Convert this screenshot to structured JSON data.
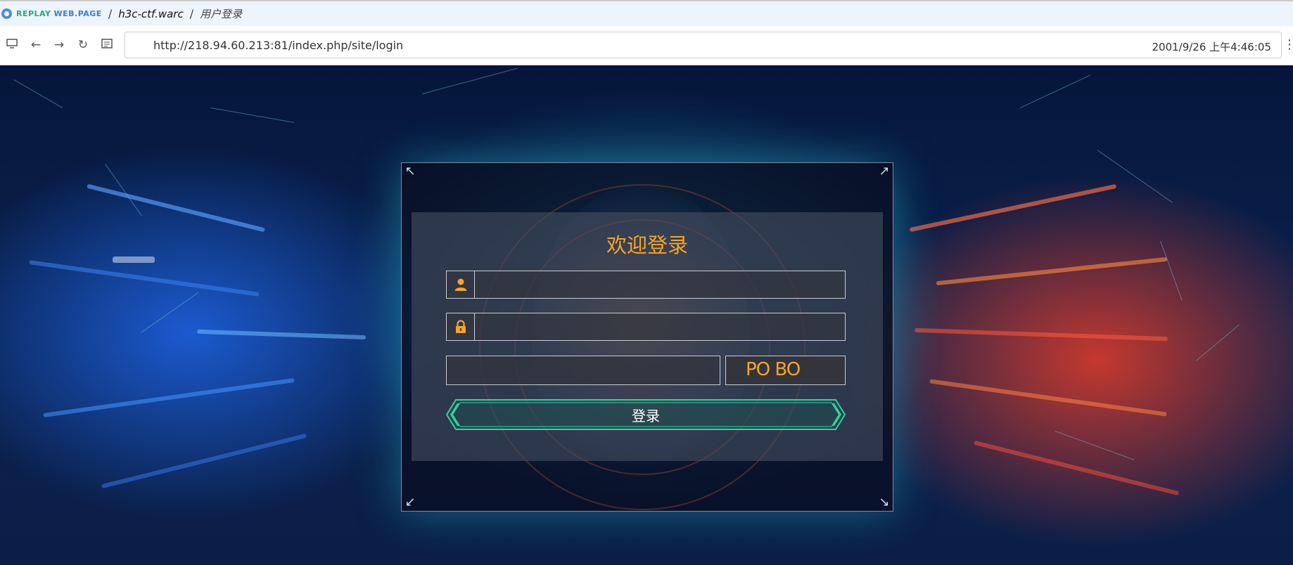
{
  "breadcrumb": {
    "brand_replay": "REPLAY",
    "brand_web": "WEB.PAGE",
    "separator": "/",
    "file": "h3c-ctf.warc",
    "page_title": "用户登录"
  },
  "address_bar": {
    "url": "http://218.94.60.213:81/index.php/site/login",
    "timestamp": "2001/9/26 上午4:46:05"
  },
  "login": {
    "title": "欢迎登录",
    "username_value": "",
    "password_value": "",
    "captcha_value": "",
    "captcha_text": "PO BO",
    "submit_label": "登录"
  },
  "colors": {
    "accent": "#f5a623",
    "button_border": "#2fd4a0"
  }
}
